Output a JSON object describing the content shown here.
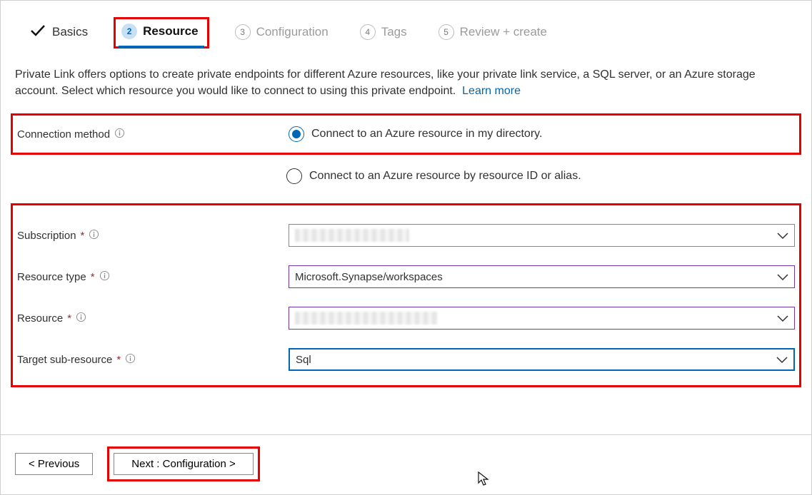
{
  "tabs": {
    "basics": "Basics",
    "resource_num": "2",
    "resource": "Resource",
    "config_num": "3",
    "config": "Configuration",
    "tags_num": "4",
    "tags": "Tags",
    "review_num": "5",
    "review": "Review + create"
  },
  "desc": {
    "text": "Private Link offers options to create private endpoints for different Azure resources, like your private link service, a SQL server, or an Azure storage account. Select which resource you would like to connect to using this private endpoint.",
    "learn_more": "Learn more"
  },
  "form": {
    "connection_method_label": "Connection method",
    "radio_directory": "Connect to an Azure resource in my directory.",
    "radio_id": "Connect to an Azure resource by resource ID or alias.",
    "subscription_label": "Subscription",
    "resource_type_label": "Resource type",
    "resource_type_value": "Microsoft.Synapse/workspaces",
    "resource_label": "Resource",
    "target_sub_label": "Target sub-resource",
    "target_sub_value": "Sql"
  },
  "footer": {
    "previous": "< Previous",
    "next": "Next : Configuration >"
  }
}
